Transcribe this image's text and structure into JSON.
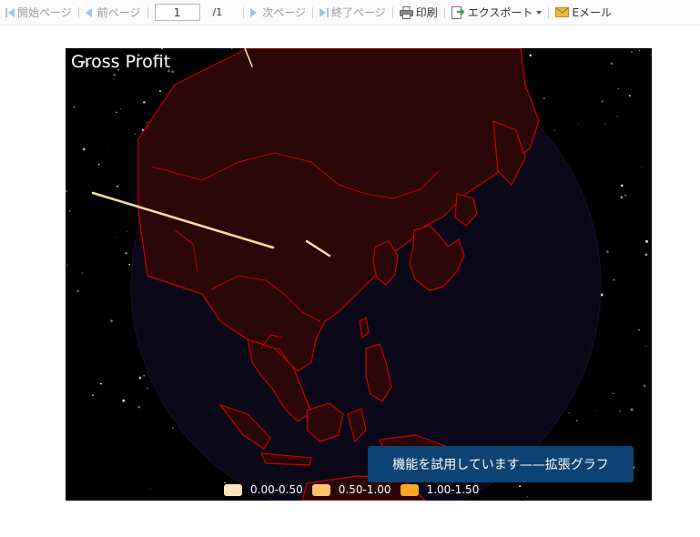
{
  "toolbar": {
    "first_page": "開始ページ",
    "prev_page": "前ページ",
    "page_value": "1",
    "page_total": "/1",
    "next_page": "次ページ",
    "last_page": "終了ページ",
    "print": "印刷",
    "export": "エクスポート",
    "email": "Eメール"
  },
  "chart_data": {
    "type": "other",
    "title": "Gross Profit",
    "legend": [
      {
        "label": "0.00-0.50",
        "color": "#fde4bd"
      },
      {
        "label": "0.50-1.00",
        "color": "#fdc16f"
      },
      {
        "label": "1.00-1.50",
        "color": "#fca628"
      }
    ]
  },
  "trial_notice": "機能を試用しています——拡張グラフ",
  "colors": {
    "globe_ocean": "#0a0818",
    "land_fill": "#2a0606",
    "border": "#cc0000",
    "bar_primary": "#f3df9a",
    "bar_secondary": "#fde4bd"
  }
}
